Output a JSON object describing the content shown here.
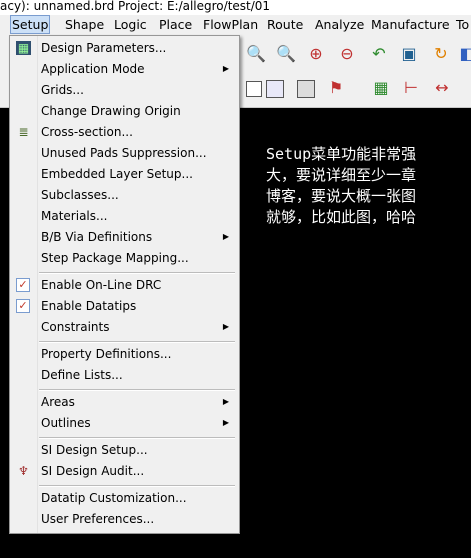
{
  "window": {
    "title": "acy): unnamed.brd  Project: E:/allegro/test/01"
  },
  "menubar": {
    "items": [
      "Setup",
      "Shape",
      "Logic",
      "Place",
      "FlowPlan",
      "Route",
      "Analyze",
      "Manufacture",
      "To"
    ]
  },
  "setup_menu": {
    "items": [
      {
        "label": "Design Parameters...",
        "icon": "design-parameters-icon"
      },
      {
        "label": "Application Mode",
        "submenu": true
      },
      {
        "label": "Grids..."
      },
      {
        "label": "Change Drawing Origin"
      },
      {
        "label": "Cross-section...",
        "icon": "cross-section-icon"
      },
      {
        "label": "Unused Pads Suppression..."
      },
      {
        "label": "Embedded Layer Setup..."
      },
      {
        "label": "Subclasses..."
      },
      {
        "label": "Materials..."
      },
      {
        "label": "B/B Via Definitions",
        "submenu": true
      },
      {
        "label": "Step Package Mapping..."
      },
      {
        "label": "Enable On-Line DRC",
        "checked": true
      },
      {
        "label": "Enable Datatips",
        "checked": true
      },
      {
        "label": "Constraints",
        "submenu": true
      },
      {
        "label": "Property Definitions..."
      },
      {
        "label": "Define Lists..."
      },
      {
        "label": "Areas",
        "submenu": true
      },
      {
        "label": "Outlines",
        "submenu": true
      },
      {
        "label": "SI Design Setup..."
      },
      {
        "label": "SI Design Audit...",
        "icon": "si-audit-icon"
      },
      {
        "label": "Datatip Customization..."
      },
      {
        "label": "User Preferences..."
      }
    ]
  },
  "canvas": {
    "note_lines": [
      "Setup菜单功能非常强",
      "大，要说详细至少一章",
      "博客，要说大概一张图",
      "就够，比如此图，哈哈"
    ]
  },
  "colors": {
    "accent": "#cce0f7",
    "canvas": "#000000",
    "menu_bg": "#f0f0f0"
  }
}
